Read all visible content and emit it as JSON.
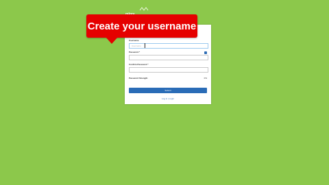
{
  "logo": {
    "text": "mlgre"
  },
  "callout": {
    "text": "Create your username"
  },
  "form": {
    "username_label": "Username",
    "username_placeholder": "Username",
    "password_label": "Password *",
    "confirm_label": "Confirm Password *",
    "strength_label": "Password Strength",
    "strength_value": "0%",
    "submit_label": "Submit",
    "login_link": "Log in | Login"
  },
  "colors": {
    "background": "#8cc84b",
    "callout": "#e50000",
    "button": "#2a6cb7"
  }
}
